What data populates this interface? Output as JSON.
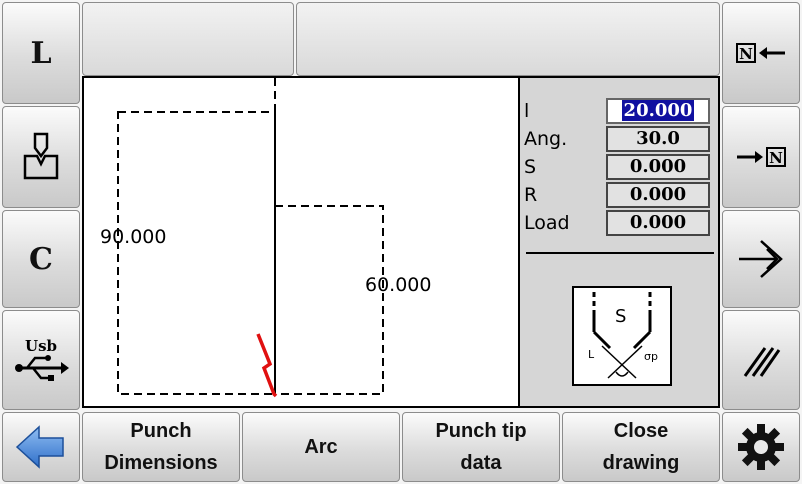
{
  "top_bar": {
    "buttons": [
      "",
      ""
    ]
  },
  "left_sidebar": {
    "items": [
      {
        "label": "L",
        "icon": "L-letter"
      },
      {
        "label": "",
        "icon": "punch-tool-icon"
      },
      {
        "label": "C",
        "icon": "C-letter"
      },
      {
        "label": "Usb",
        "icon": "usb-icon"
      }
    ]
  },
  "right_sidebar": {
    "items": [
      {
        "icon": "export-arrow-icon"
      },
      {
        "icon": "import-arrow-icon"
      },
      {
        "icon": "login-arrow-icon"
      },
      {
        "icon": "hatch-icon"
      }
    ]
  },
  "drawing": {
    "dim_left": "90.000",
    "dim_right": "60.000"
  },
  "params": {
    "rows": [
      {
        "label": "l",
        "value": "20.000",
        "active": true
      },
      {
        "label": "Ang.",
        "value": "30.0"
      },
      {
        "label": "S",
        "value": "0.000"
      },
      {
        "label": "R",
        "value": "0.000"
      },
      {
        "label": "Load",
        "value": "0.000"
      }
    ],
    "diagram": {
      "s": "S",
      "l": "L",
      "sp": "σp"
    }
  },
  "bottom_bar": {
    "buttons": [
      {
        "label": "Punch\nDimensions"
      },
      {
        "label": "Arc"
      },
      {
        "label": "Punch tip\ndata"
      },
      {
        "label": "Close\ndrawing"
      }
    ]
  },
  "colors": {
    "accent_blue": "#3d7fd6",
    "active_field": "#1010a0",
    "profile_red": "#e01010"
  }
}
